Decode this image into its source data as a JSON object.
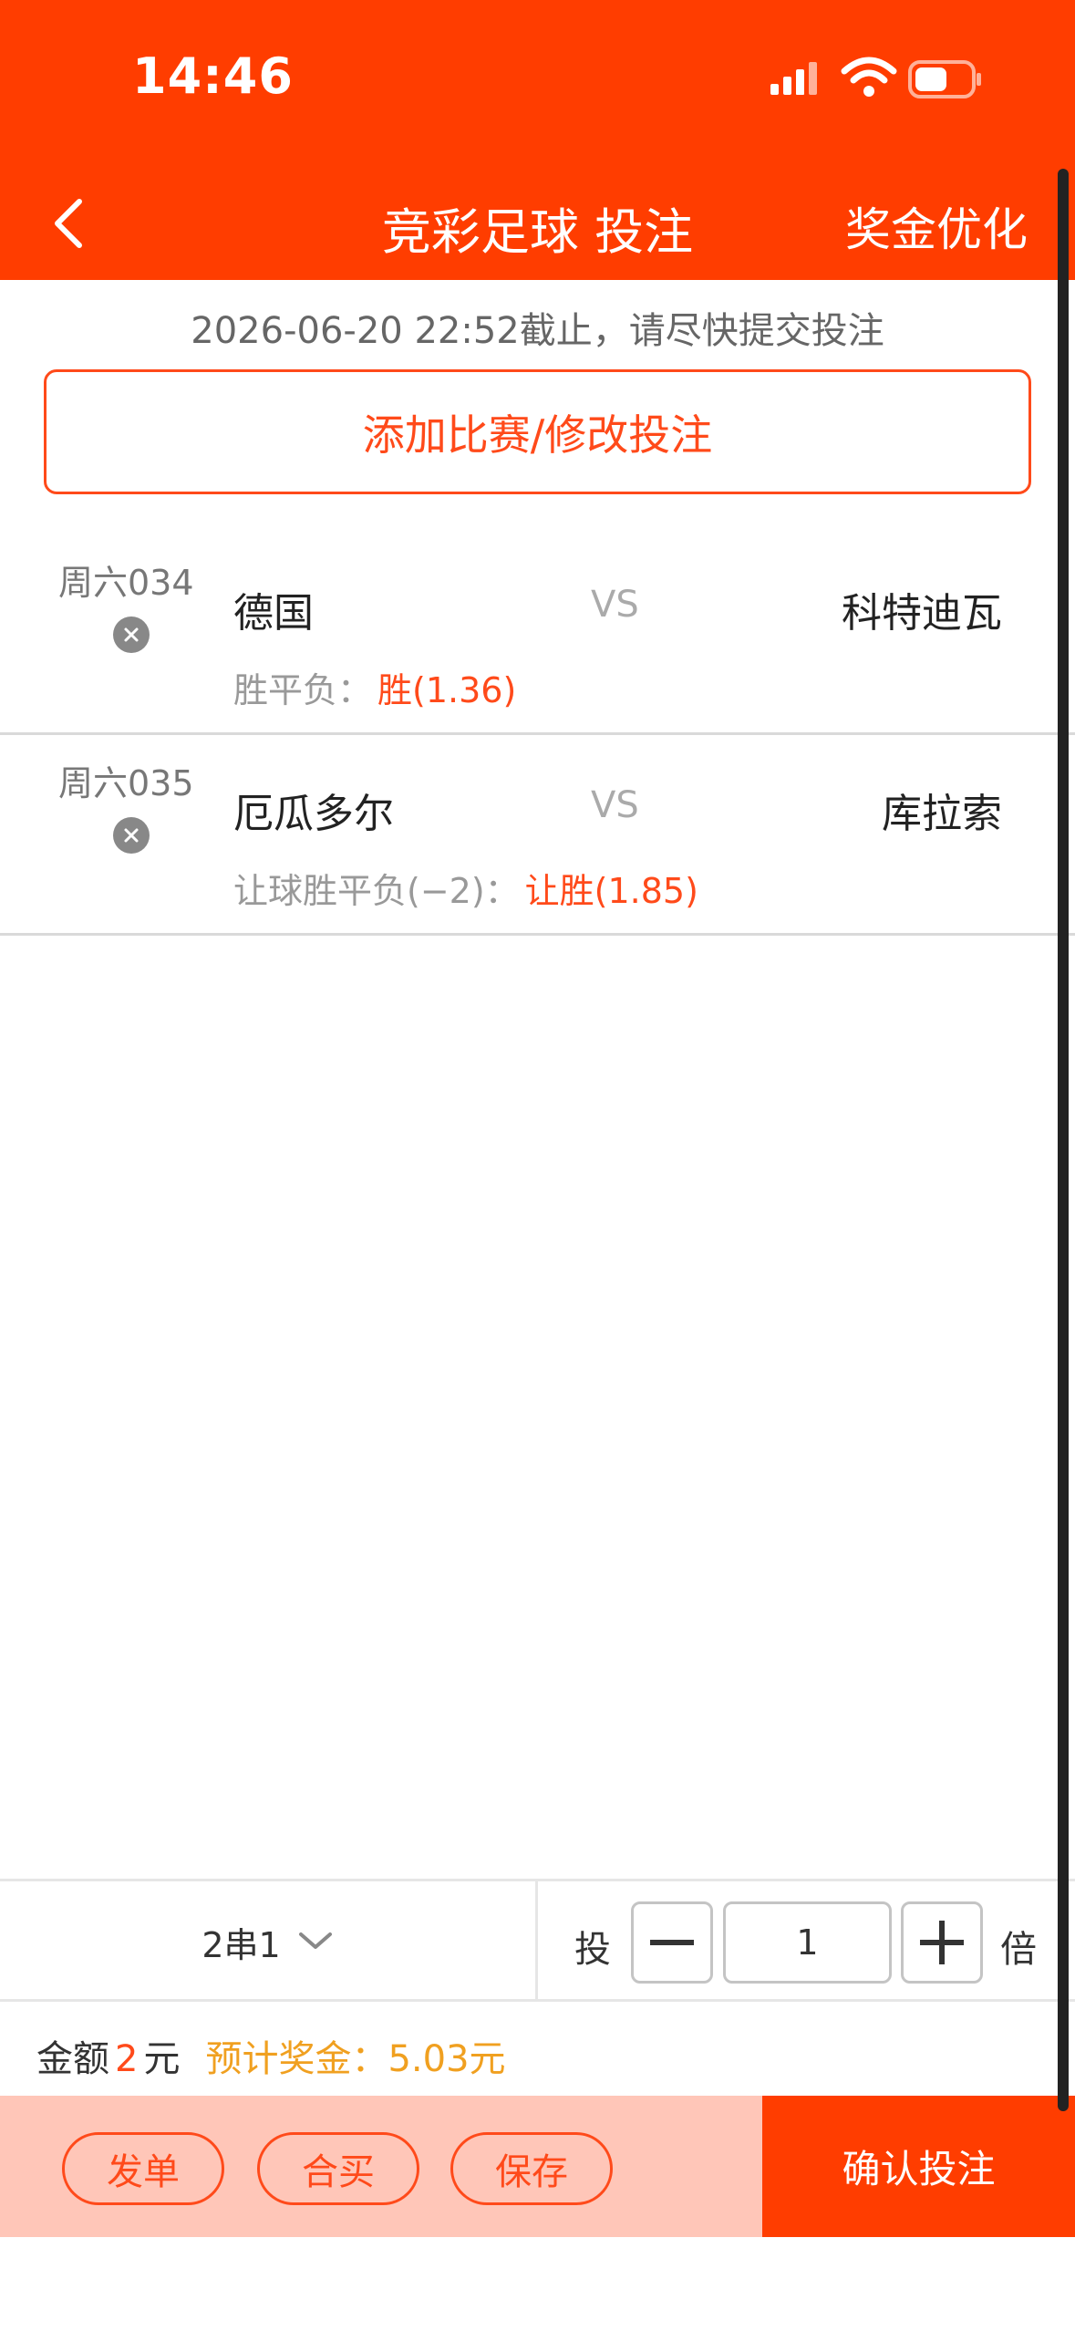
{
  "status_bar": {
    "time": "14:46"
  },
  "nav": {
    "back_icon": "chevron-left-icon",
    "title": "竞彩足球 投注",
    "right_action": "奖金优化"
  },
  "deadline_text": "2026-06-20 22:52截止，请尽快提交投注",
  "add_button": "添加比赛/修改投注",
  "matches": [
    {
      "no": "周六034",
      "home": "德国",
      "vs": "VS",
      "away": "科特迪瓦",
      "play": "胜平负：",
      "pick": "胜(1.36)"
    },
    {
      "no": "周六035",
      "home": "厄瓜多尔",
      "vs": "VS",
      "away": "库拉索",
      "play": "让球胜平负(−2)：",
      "pick": "让胜(1.85)"
    }
  ],
  "pass": {
    "label": "2串1"
  },
  "multiplier": {
    "prefix": "投",
    "value": "1",
    "suffix": "倍"
  },
  "amount": {
    "label": "金额",
    "value": "2",
    "unit": "元",
    "prize_label": "预计奖金：",
    "prize_value": "5.03元"
  },
  "actions": {
    "share": "发单",
    "group_buy": "合买",
    "save": "保存",
    "confirm": "确认投注"
  },
  "colors": {
    "brand": "#ff3d00",
    "accent": "#ff4a1a",
    "action_bg": "#ffc6b8",
    "prize": "#f0a020"
  }
}
